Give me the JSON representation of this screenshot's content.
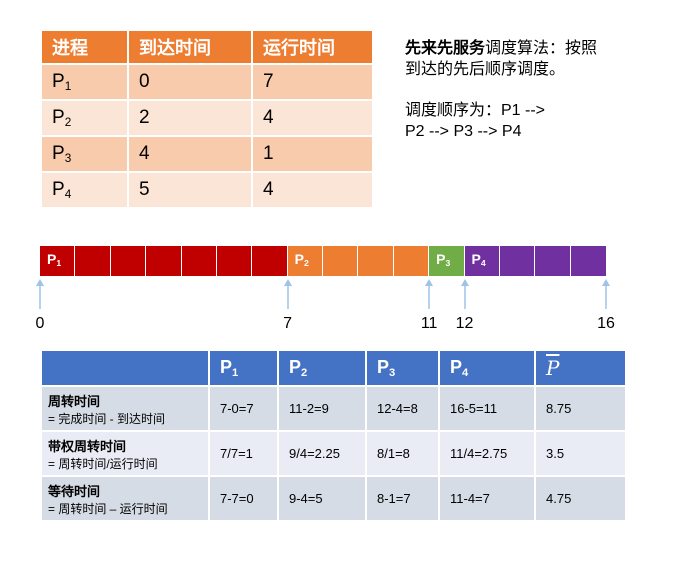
{
  "process_table": {
    "headers": [
      "进程",
      "到达时间",
      "运行时间"
    ],
    "rows": [
      {
        "name": "P",
        "sub": "1",
        "arrival": "0",
        "runtime": "7"
      },
      {
        "name": "P",
        "sub": "2",
        "arrival": "2",
        "runtime": "4"
      },
      {
        "name": "P",
        "sub": "3",
        "arrival": "4",
        "runtime": "1"
      },
      {
        "name": "P",
        "sub": "4",
        "arrival": "5",
        "runtime": "4"
      }
    ]
  },
  "description": {
    "algorithm_bold": "先来先服务",
    "algorithm_rest": "调度算法：按照到达的先后顺序调度。",
    "order_line1": "调度顺序为：P1 -->",
    "order_line2": "P2 --> P3 --> P4"
  },
  "gantt": {
    "total": 16,
    "segments": [
      {
        "name": "P",
        "sub": "1",
        "start": 0,
        "end": 7,
        "color": "#C00000"
      },
      {
        "name": "P",
        "sub": "2",
        "start": 7,
        "end": 11,
        "color": "#ED7D31"
      },
      {
        "name": "P",
        "sub": "3",
        "start": 11,
        "end": 12,
        "color": "#70AD47"
      },
      {
        "name": "P",
        "sub": "4",
        "start": 12,
        "end": 16,
        "color": "#7030A0"
      }
    ],
    "ticks": [
      "0",
      "7",
      "11",
      "12",
      "16"
    ],
    "arrow_color": "#9DC3E6"
  },
  "metrics_table": {
    "headers": [
      {
        "name": "P",
        "sub": "1"
      },
      {
        "name": "P",
        "sub": "2"
      },
      {
        "name": "P",
        "sub": "3"
      },
      {
        "name": "P",
        "sub": "4"
      },
      {
        "name": "P",
        "sub": ""
      }
    ],
    "rows": [
      {
        "title": "周转时间",
        "formula": "= 完成时间 - 到达时间",
        "values": [
          "7-0=7",
          "11-2=9",
          "12-4=8",
          "16-5=11",
          "8.75"
        ]
      },
      {
        "title": "带权周转时间",
        "formula": "= 周转时间/运行时间",
        "values": [
          "7/7=1",
          "9/4=2.25",
          "8/1=8",
          "11/4=2.75",
          "3.5"
        ]
      },
      {
        "title": "等待时间",
        "formula": "= 周转时间 – 运行时间",
        "values": [
          "7-7=0",
          "9-4=5",
          "8-1=7",
          "11-4=7",
          "4.75"
        ]
      }
    ]
  },
  "colors": {
    "orange": "#ED7D31",
    "blue": "#4472C4"
  }
}
